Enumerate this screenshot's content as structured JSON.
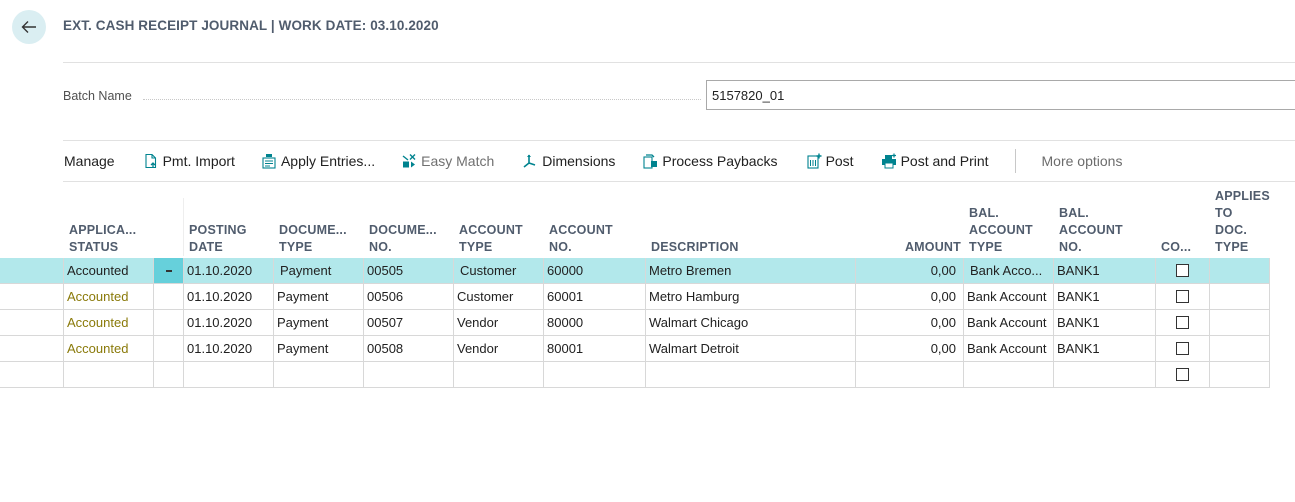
{
  "header": {
    "title": "EXT. CASH RECEIPT JOURNAL | WORK DATE: 03.10.2020",
    "back_icon": "arrow-left-icon"
  },
  "batch": {
    "label": "Batch Name",
    "value": "5157820_01"
  },
  "actions": [
    {
      "label": "Manage",
      "icon": null,
      "enabled": true
    },
    {
      "label": "Pmt. Import",
      "icon": "document-import-icon",
      "enabled": true
    },
    {
      "label": "Apply Entries...",
      "icon": "apply-entries-icon",
      "enabled": true
    },
    {
      "label": "Easy Match",
      "icon": "easy-match-icon",
      "enabled": false
    },
    {
      "label": "Dimensions",
      "icon": "dimensions-icon",
      "enabled": true
    },
    {
      "label": "Process Paybacks",
      "icon": "process-paybacks-icon",
      "enabled": true
    },
    {
      "label": "Post",
      "icon": "post-icon",
      "enabled": true
    },
    {
      "label": "Post and Print",
      "icon": "print-icon",
      "enabled": true
    }
  ],
  "more_options": "More options",
  "columns": [
    {
      "key": "status",
      "line1": "APPLICA...",
      "line2": "STATUS"
    },
    {
      "key": "posting_date",
      "line1": "POSTING",
      "line2": "DATE"
    },
    {
      "key": "doc_type",
      "line1": "DOCUME...",
      "line2": "TYPE"
    },
    {
      "key": "doc_no",
      "line1": "DOCUME...",
      "line2": "NO."
    },
    {
      "key": "account_type",
      "line1": "ACCOUNT",
      "line2": "TYPE"
    },
    {
      "key": "account_no",
      "line1": "ACCOUNT",
      "line2": "NO."
    },
    {
      "key": "description",
      "line1": "",
      "line2": "DESCRIPTION"
    },
    {
      "key": "amount",
      "line1": "",
      "line2": "AMOUNT"
    },
    {
      "key": "bal_account_type",
      "line0": "BAL.",
      "line1": "ACCOUNT",
      "line2": "TYPE"
    },
    {
      "key": "bal_account_no",
      "line0": "BAL.",
      "line1": "ACCOUNT",
      "line2": "NO."
    },
    {
      "key": "correction",
      "line1": "",
      "line2": "CO..."
    },
    {
      "key": "applies_to_doc_type",
      "line0": "APPLIES",
      "line1": "TO DOC.",
      "line2": "TYPE"
    }
  ],
  "rows": [
    {
      "status": "Accounted",
      "posting_date": "01.10.2020",
      "doc_type": "Payment",
      "doc_no": "00505",
      "account_type": "Customer",
      "account_no": "60000",
      "description": "Metro Bremen",
      "amount": "0,00",
      "bal_account_type": "Bank Acco...",
      "bal_account_no": "BANK1",
      "correction": false,
      "applies_to_doc_type": "",
      "selected": true
    },
    {
      "status": "Accounted",
      "posting_date": "01.10.2020",
      "doc_type": "Payment",
      "doc_no": "00506",
      "account_type": "Customer",
      "account_no": "60001",
      "description": "Metro Hamburg",
      "amount": "0,00",
      "bal_account_type": "Bank Account",
      "bal_account_no": "BANK1",
      "correction": false,
      "applies_to_doc_type": ""
    },
    {
      "status": "Accounted",
      "posting_date": "01.10.2020",
      "doc_type": "Payment",
      "doc_no": "00507",
      "account_type": "Vendor",
      "account_no": "80000",
      "description": "Walmart Chicago",
      "amount": "0,00",
      "bal_account_type": "Bank Account",
      "bal_account_no": "BANK1",
      "correction": false,
      "applies_to_doc_type": ""
    },
    {
      "status": "Accounted",
      "posting_date": "01.10.2020",
      "doc_type": "Payment",
      "doc_no": "00508",
      "account_type": "Vendor",
      "account_no": "80001",
      "description": "Walmart Detroit",
      "amount": "0,00",
      "bal_account_type": "Bank Account",
      "bal_account_no": "BANK1",
      "correction": false,
      "applies_to_doc_type": ""
    },
    {
      "status": "",
      "posting_date": "",
      "doc_type": "",
      "doc_no": "",
      "account_type": "",
      "account_no": "",
      "description": "",
      "amount": "",
      "bal_account_type": "",
      "bal_account_no": "",
      "correction": false,
      "applies_to_doc_type": ""
    }
  ],
  "colors": {
    "accent": "#00838f",
    "selected_row": "#b2e8eb",
    "row_menu": "#66d0db",
    "status_text": "#8a7a0a",
    "header_text": "#505c6d"
  }
}
